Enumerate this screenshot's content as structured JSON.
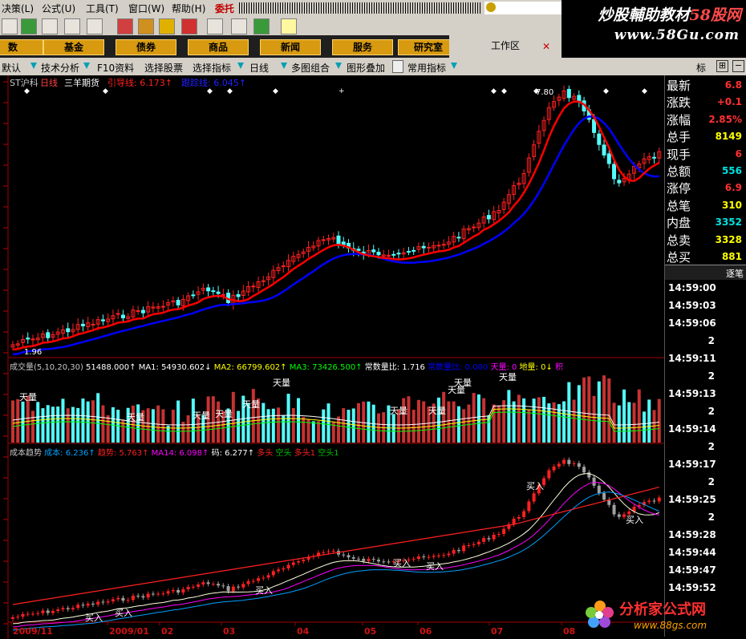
{
  "menu": {
    "items": [
      "决策(L)",
      "公式(U)",
      "工具(T)",
      "窗口(W)",
      "帮助(H)"
    ],
    "highlight": "委托"
  },
  "watermark": {
    "line1_a": "炒股輔助教材",
    "line1_b": "58股网",
    "line2": "www.58Gu.com"
  },
  "func_buttons": [
    "数",
    "基金",
    "债券",
    "商品",
    "新闻",
    "服务",
    "研究室"
  ],
  "workarea_label": "工作区",
  "tabs": [
    "默认",
    "技术分析",
    "F10资料",
    "选择股票",
    "选择指标",
    "日线",
    "多图组合",
    "图形叠加",
    "常用指标"
  ],
  "tab_right": "标",
  "price_panel": {
    "stock": "ST沪科",
    "period": "日线",
    "indicator": "三羊期货",
    "line1": "引导线: 6.173↑",
    "line2": "跟踪线: 6.045↑",
    "high_label": "7.80",
    "low_label": "1.96"
  },
  "volume_panel": {
    "header_parts": [
      {
        "t": "成交量(5,10,20,30)",
        "c": "#c8c8c8"
      },
      {
        "t": " 51488.000↑",
        "c": "#ffffff"
      },
      {
        "t": " MA1: 54930.602↓",
        "c": "#ffffff"
      },
      {
        "t": " MA2: 66799.602↑",
        "c": "#ffff00"
      },
      {
        "t": " MA3: 73426.500↑",
        "c": "#00ff00"
      },
      {
        "t": " 常数量比: 1.716",
        "c": "#ffffff"
      },
      {
        "t": " 常数量比: 0.000",
        "c": "#0000ff"
      },
      {
        "t": " 天量: 0",
        "c": "#ff00ff"
      },
      {
        "t": " 地量: 0↓",
        "c": "#ffff00"
      },
      {
        "t": " 积",
        "c": "#ff00ff"
      }
    ],
    "tianliang_label": "天量"
  },
  "cost_panel": {
    "header_parts": [
      {
        "t": "成本趋势",
        "c": "#c8c8c8"
      },
      {
        "t": "  成本: 6.236↑",
        "c": "#00a0ff"
      },
      {
        "t": "  趋势: 5.763↑",
        "c": "#ff2020"
      },
      {
        "t": "  MA14: 6.098↑",
        "c": "#ff00ff"
      },
      {
        "t": "  码: 6.277↑",
        "c": "#ffffff"
      },
      {
        "t": "  多头",
        "c": "#ff2020"
      },
      {
        "t": "  空头",
        "c": "#00c000"
      },
      {
        "t": "  多头1",
        "c": "#ff2020"
      },
      {
        "t": "  空头1",
        "c": "#00c000"
      }
    ],
    "buy_label": "买入"
  },
  "date_axis": [
    "2009/11",
    "2009/01",
    "02",
    "03",
    "04",
    "05",
    "06",
    "07",
    "08"
  ],
  "quote": [
    {
      "label": "最新",
      "value": "6.8",
      "color": "#ff3030"
    },
    {
      "label": "涨跌",
      "value": "+0.1",
      "color": "#ff3030"
    },
    {
      "label": "涨幅",
      "value": "2.85%",
      "color": "#ff3030"
    },
    {
      "label": "总手",
      "value": "8149",
      "color": "#ffff00"
    },
    {
      "label": "现手",
      "value": "6",
      "color": "#ff3030"
    },
    {
      "label": "总额",
      "value": "556",
      "color": "#00e0e0"
    },
    {
      "label": "涨停",
      "value": "6.9",
      "color": "#ff3030"
    },
    {
      "label": "总笔",
      "value": "310",
      "color": "#ffff00"
    },
    {
      "label": "内盘",
      "value": "3352",
      "color": "#00e0e0"
    },
    {
      "label": "总卖",
      "value": "3328",
      "color": "#ffff00"
    },
    {
      "label": "总买",
      "value": "881",
      "color": "#ffff00"
    }
  ],
  "ticks_header": "逐笔",
  "ticks": [
    {
      "time": "14:59:00",
      "vol": ""
    },
    {
      "time": "14:59:03",
      "vol": ""
    },
    {
      "time": "14:59:06",
      "vol": ""
    },
    {
      "time": "",
      "vol": "2"
    },
    {
      "time": "14:59:11",
      "vol": ""
    },
    {
      "time": "",
      "vol": "2"
    },
    {
      "time": "14:59:13",
      "vol": ""
    },
    {
      "time": "",
      "vol": "2"
    },
    {
      "time": "14:59:14",
      "vol": ""
    },
    {
      "time": "",
      "vol": "2"
    },
    {
      "time": "14:59:17",
      "vol": ""
    },
    {
      "time": "",
      "vol": "2"
    },
    {
      "time": "14:59:25",
      "vol": ""
    },
    {
      "time": "",
      "vol": "2"
    },
    {
      "time": "14:59:28",
      "vol": ""
    },
    {
      "time": "14:59:44",
      "vol": ""
    },
    {
      "time": "14:59:47",
      "vol": ""
    },
    {
      "time": "14:59:52",
      "vol": ""
    }
  ],
  "logo": {
    "text": "分析家公式网",
    "url": "www.88gs.com"
  },
  "colors": {
    "up": "#ff2020",
    "down": "#54ffff",
    "guide": "#ff0000",
    "track": "#0000ff",
    "bg": "#000000"
  }
}
